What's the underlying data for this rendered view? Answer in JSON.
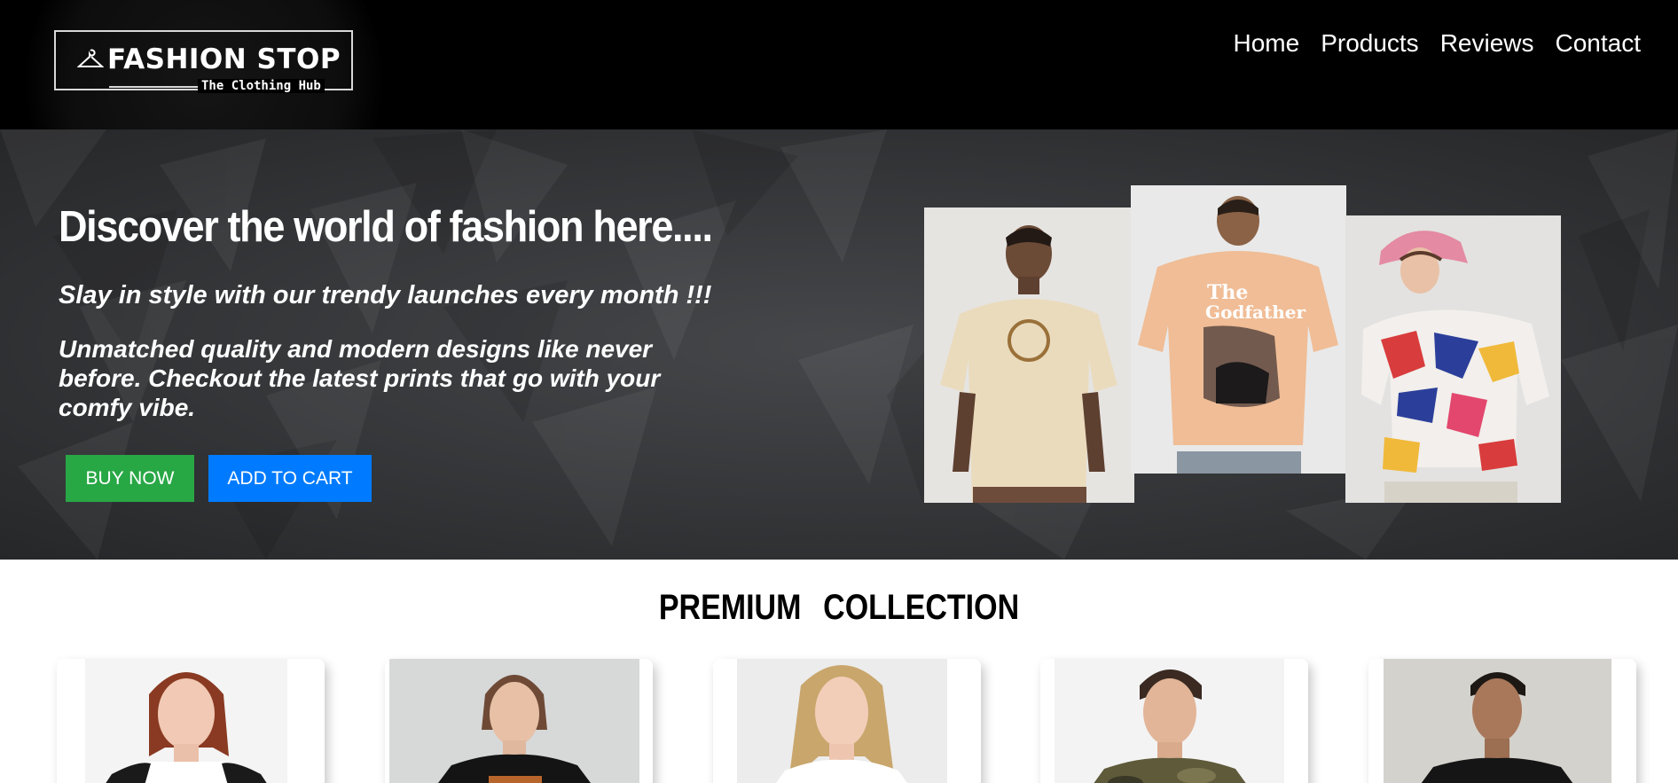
{
  "header": {
    "logo": {
      "title": "FASHION STOP",
      "subtitle": "The Clothing Hub",
      "icon": "hanger-icon"
    },
    "nav": [
      {
        "label": "Home"
      },
      {
        "label": "Products"
      },
      {
        "label": "Reviews"
      },
      {
        "label": "Contact"
      }
    ]
  },
  "hero": {
    "title": "Discover the world of fashion here....",
    "tagline": "Slay in style with our trendy launches every month !!!",
    "description": "Unmatched quality and modern designs like never before. Checkout the latest prints that go with your comfy vibe.",
    "buttons": {
      "buy_now": "BUY NOW",
      "add_to_cart": "ADD TO CART"
    },
    "photos": [
      {
        "alt": "man in cream printed t-shirt"
      },
      {
        "alt": "man in peach oversized graphic t-shirt, back view"
      },
      {
        "alt": "woman in multicolor abstract print t-shirt with pink bucket hat"
      }
    ]
  },
  "collection": {
    "title": "PREMIUM   COLLECTION",
    "products": [
      {
        "alt": "woman in white and black raglan t-shirt"
      },
      {
        "alt": "woman in black graphic t-shirt"
      },
      {
        "alt": "woman in white t-shirt"
      },
      {
        "alt": "man in camouflage t-shirt"
      },
      {
        "alt": "man in black t-shirt"
      }
    ]
  },
  "colors": {
    "header_bg": "#000000",
    "buy_now": "#28a745",
    "add_to_cart": "#007bff"
  }
}
